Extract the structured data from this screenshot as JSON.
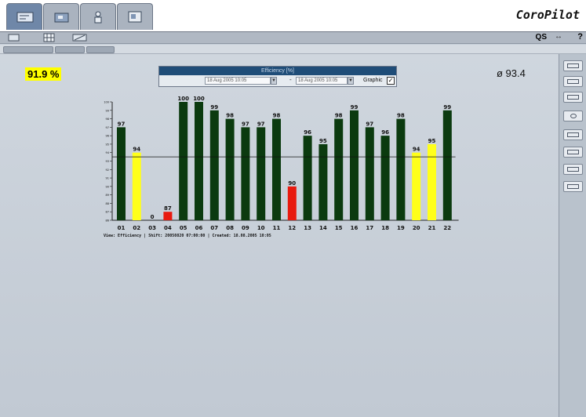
{
  "app": {
    "brand": "CoroPilot"
  },
  "tabs": [
    {
      "name": "tab-overview",
      "active": true
    },
    {
      "name": "tab-machines",
      "active": false
    },
    {
      "name": "tab-personnel",
      "active": false
    },
    {
      "name": "tab-reports",
      "active": false
    }
  ],
  "toolbar": {
    "qs_label": "QS",
    "help_label": "?",
    "arrow_label": "↔"
  },
  "header": {
    "efficiency_value": "91.9 %",
    "average_value": "ø 93.4"
  },
  "filter": {
    "title": "Efficiency [%]",
    "from_date": "18 Aug 2005 10:05",
    "to_date": "18 Aug 2005 10:05",
    "graphic_label": "Graphic",
    "graphic_checked": true
  },
  "footer": {
    "text": "View: Efficiency  |  Shift: 20050820 07:00:00  |  Created: 18.08.2005  10:05"
  },
  "colors": {
    "good": "#0b3a0f",
    "warn": "#ffff1a",
    "bad": "#e81a0f"
  },
  "chart_data": {
    "type": "bar",
    "categories": [
      "01",
      "02",
      "03",
      "04",
      "05",
      "06",
      "07",
      "08",
      "09",
      "10",
      "11",
      "12",
      "13",
      "14",
      "15",
      "16",
      "17",
      "18",
      "19",
      "20",
      "21",
      "22"
    ],
    "values": [
      97,
      94,
      0,
      87,
      100,
      100,
      99,
      98,
      97,
      97,
      98,
      90,
      96,
      95,
      98,
      99,
      97,
      96,
      98,
      94,
      95,
      99
    ],
    "bar_status": [
      "good",
      "warn",
      "bad",
      "bad",
      "good",
      "good",
      "good",
      "good",
      "good",
      "good",
      "good",
      "bad",
      "good",
      "good",
      "good",
      "good",
      "good",
      "good",
      "good",
      "warn",
      "warn",
      "good"
    ],
    "ylim": [
      86,
      100
    ],
    "reference_line": 93.5,
    "y_ticks": [
      "100",
      "99",
      "98",
      "97",
      "96",
      "95",
      "94",
      "93",
      "92",
      "91",
      "90",
      "89",
      "88",
      "87",
      "86"
    ]
  }
}
